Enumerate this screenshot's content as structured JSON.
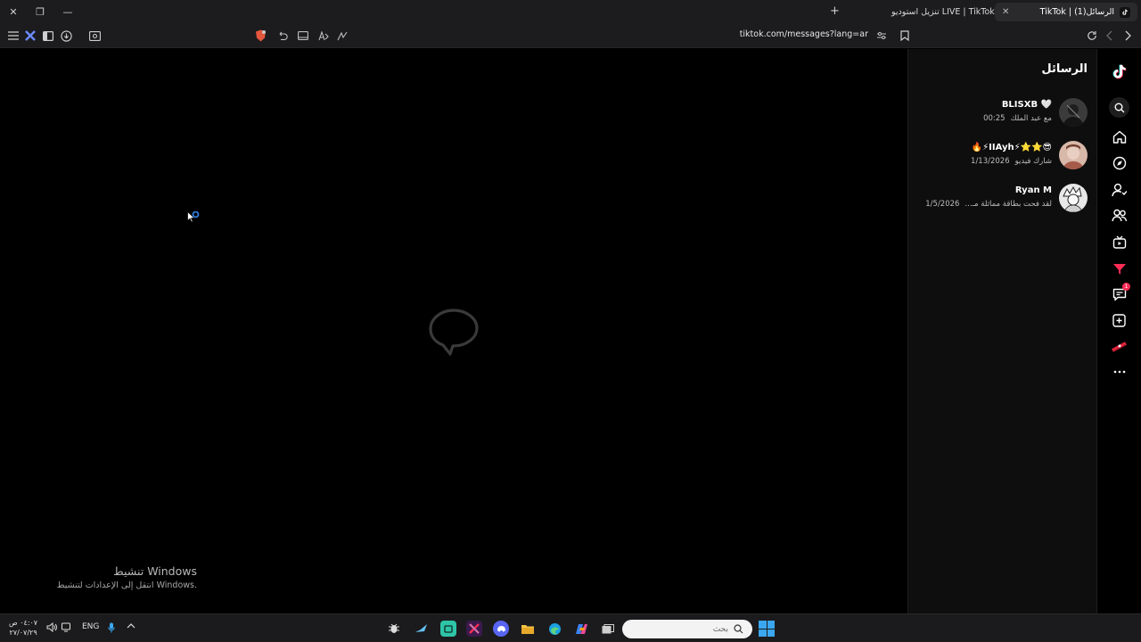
{
  "browser": {
    "tabs": [
      {
        "label": "TikTok | (1)الرسائل",
        "active": true
      },
      {
        "label": "تنزيل استوديو LIVE | TikTok",
        "active": false
      }
    ],
    "url": "tiktok.com/messages?lang=ar"
  },
  "main": {
    "activation_title": "تنشيط Windows",
    "activation_subtitle": "انتقل إلى الإعدادات لتنشيط Windows."
  },
  "messages": {
    "title": "الرسائل",
    "conversations": [
      {
        "name": "BLISXB 🤍",
        "preview": "مع عبد الملك",
        "time": "00:25"
      },
      {
        "name": "🔥⚡IIAyh⚡⭐⭐😎",
        "preview": "شارك فيديو",
        "time": "1/13/2026"
      },
      {
        "name": "Ryan M",
        "preview": "لقد فحت بطاقة مماثلة مـ...",
        "time": "1/5/2026"
      }
    ]
  },
  "rail": {
    "icons": [
      "tiktok-logo-icon",
      "search-icon",
      "home-icon",
      "explore-icon",
      "following-icon",
      "friends-icon",
      "live-icon",
      "activity-icon",
      "messages-icon",
      "upload-icon",
      "profile-icon",
      "more-icon"
    ],
    "messages_badge": "1"
  },
  "taskbar": {
    "time": "٠٤:٠٧ ص",
    "date": "٢٧/٠٧/٢٩",
    "language": "ENG",
    "search_placeholder": "بحث"
  },
  "colors": {
    "accent": "#fe2c55",
    "background": "#000000",
    "panel": "#0e0e0e"
  }
}
